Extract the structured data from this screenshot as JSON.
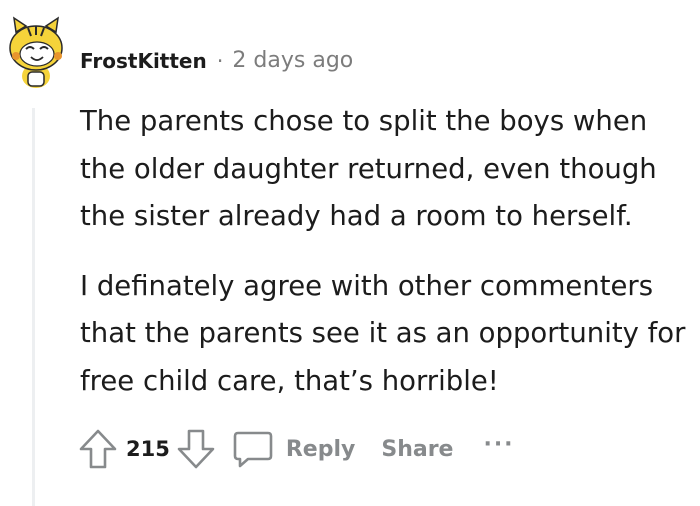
{
  "comment": {
    "author": "FrostKitten",
    "separator": "·",
    "timestamp": "2 days ago",
    "paragraphs": [
      "The parents chose to split the boys when the older daughter returned, even though the sister already had a room to herself.",
      "I definately agree with other commenters that the parents see it as an opportunity for free child care, that’s horrible!"
    ],
    "score": "215",
    "reply_label": "Reply",
    "share_label": "Share",
    "more_label": "···"
  },
  "icons": {
    "avatar": "snoo-tiger-avatar",
    "upvote": "upvote-arrow-icon",
    "downvote": "downvote-arrow-icon",
    "reply": "comment-bubble-icon"
  },
  "colors": {
    "text": "#1c1c1c",
    "meta": "#7c7c7c",
    "action": "#878a8c",
    "thread_line": "#edeff1",
    "avatar_yellow": "#f5d33a"
  }
}
